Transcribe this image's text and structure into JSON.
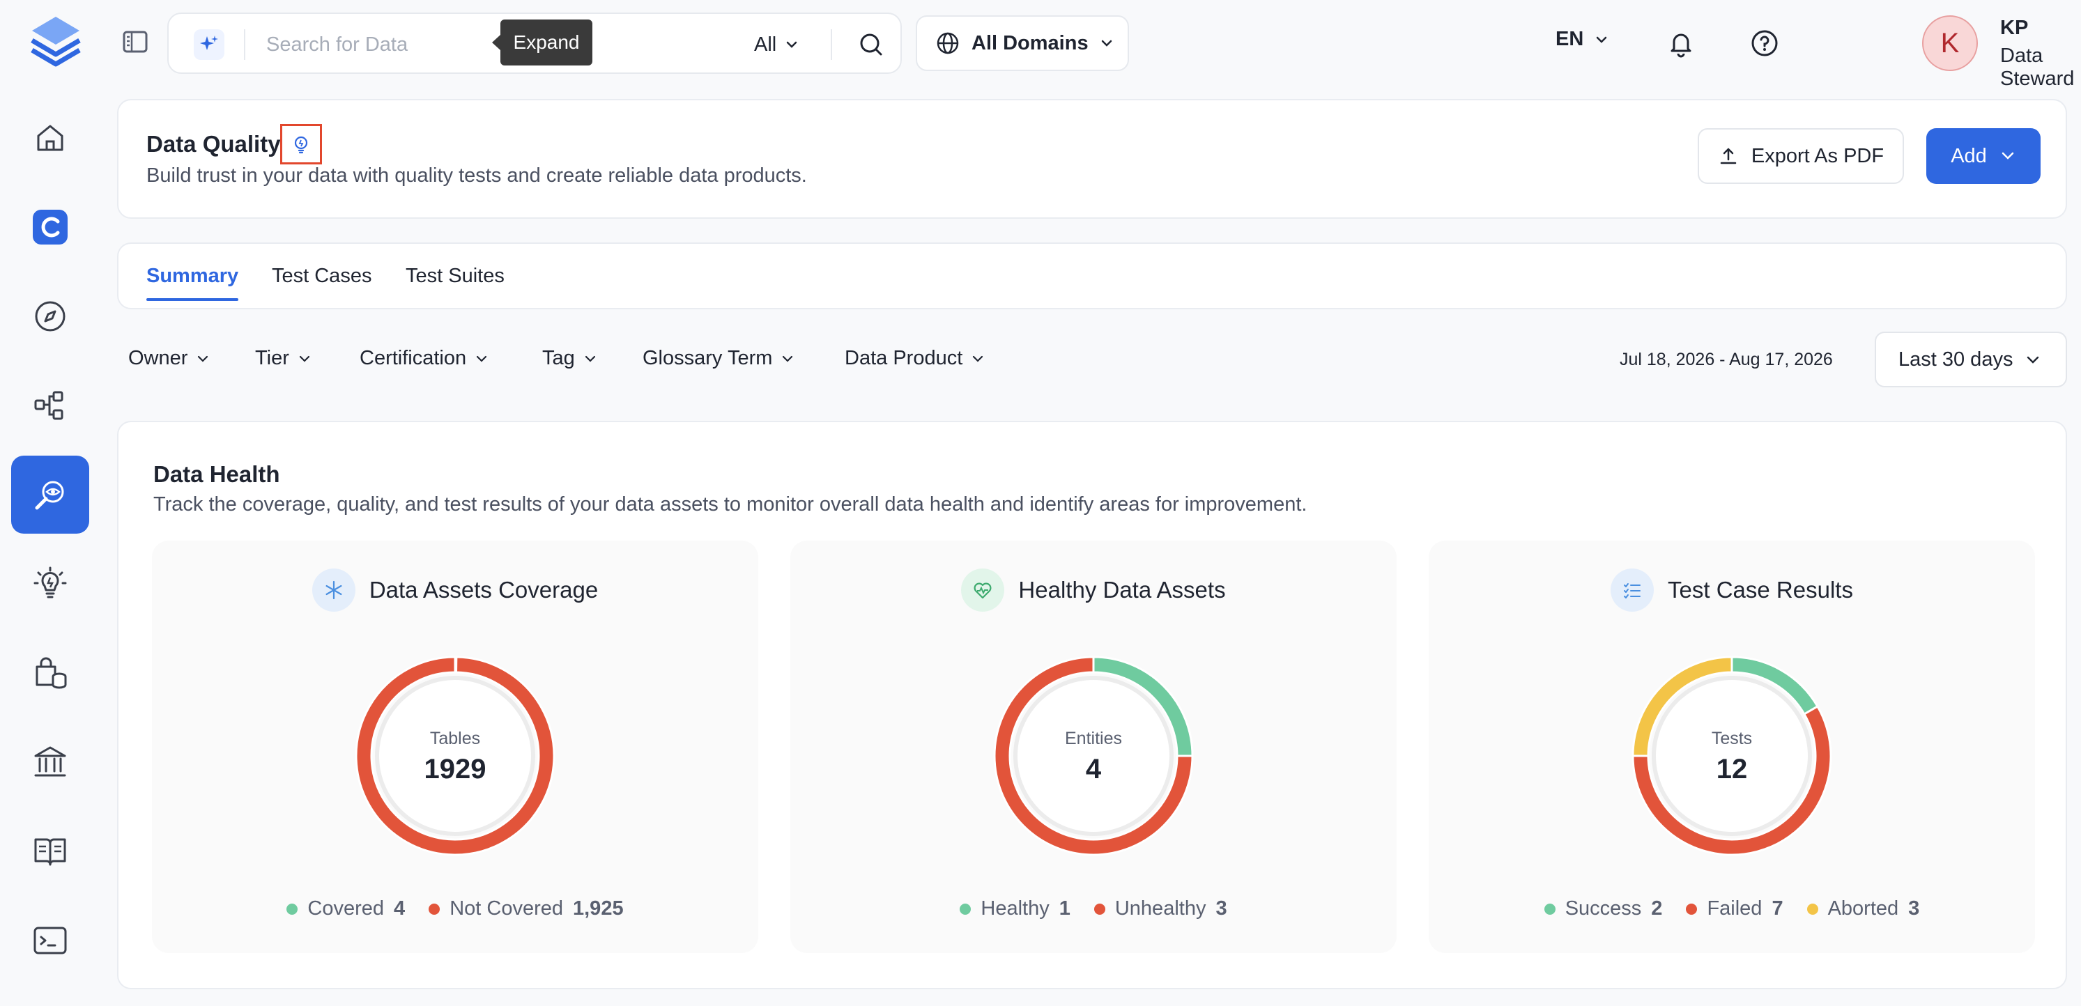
{
  "search": {
    "placeholder": "Search for Data",
    "scope": "All",
    "tooltip": "Expand"
  },
  "domains": {
    "label": "All Domains"
  },
  "lang": {
    "label": "EN"
  },
  "user": {
    "initial": "K",
    "name": "KP",
    "role": "Data Steward"
  },
  "header": {
    "title": "Data Quality",
    "subtitle": "Build trust in your data with quality tests and create reliable data products.",
    "export_label": "Export As PDF",
    "add_label": "Add"
  },
  "tabs": [
    {
      "label": "Summary"
    },
    {
      "label": "Test Cases"
    },
    {
      "label": "Test Suites"
    }
  ],
  "filters": [
    {
      "label": "Owner"
    },
    {
      "label": "Tier"
    },
    {
      "label": "Certification"
    },
    {
      "label": "Tag"
    },
    {
      "label": "Glossary Term"
    },
    {
      "label": "Data Product"
    }
  ],
  "date_range": {
    "start": "Jul 18, 2026",
    "separator": "-",
    "end": "Aug 17, 2026"
  },
  "period": {
    "label": "Last 30 days"
  },
  "health": {
    "title": "Data Health",
    "subtitle": "Track the coverage, quality, and test results of your data assets to monitor overall data health and identify areas for improvement."
  },
  "colors": {
    "accent": "#2f67e0",
    "success": "#6fcb9f",
    "failed": "#e2543a",
    "aborted": "#f3c447"
  },
  "chart_data": [
    {
      "type": "pie",
      "title": "Data Assets Coverage",
      "center_label": "Tables",
      "center_value": "1929",
      "series": [
        {
          "name": "Covered",
          "value": 4,
          "display": "4",
          "color": "#6fcb9f"
        },
        {
          "name": "Not Covered",
          "value": 1925,
          "display": "1,925",
          "color": "#e2543a"
        }
      ]
    },
    {
      "type": "pie",
      "title": "Healthy Data Assets",
      "center_label": "Entities",
      "center_value": "4",
      "series": [
        {
          "name": "Healthy",
          "value": 1,
          "display": "1",
          "color": "#6fcb9f"
        },
        {
          "name": "Unhealthy",
          "value": 3,
          "display": "3",
          "color": "#e2543a"
        }
      ]
    },
    {
      "type": "pie",
      "title": "Test Case Results",
      "center_label": "Tests",
      "center_value": "12",
      "series": [
        {
          "name": "Success",
          "value": 2,
          "display": "2",
          "color": "#6fcb9f"
        },
        {
          "name": "Failed",
          "value": 7,
          "display": "7",
          "color": "#e2543a"
        },
        {
          "name": "Aborted",
          "value": 3,
          "display": "3",
          "color": "#f3c447"
        }
      ]
    }
  ]
}
